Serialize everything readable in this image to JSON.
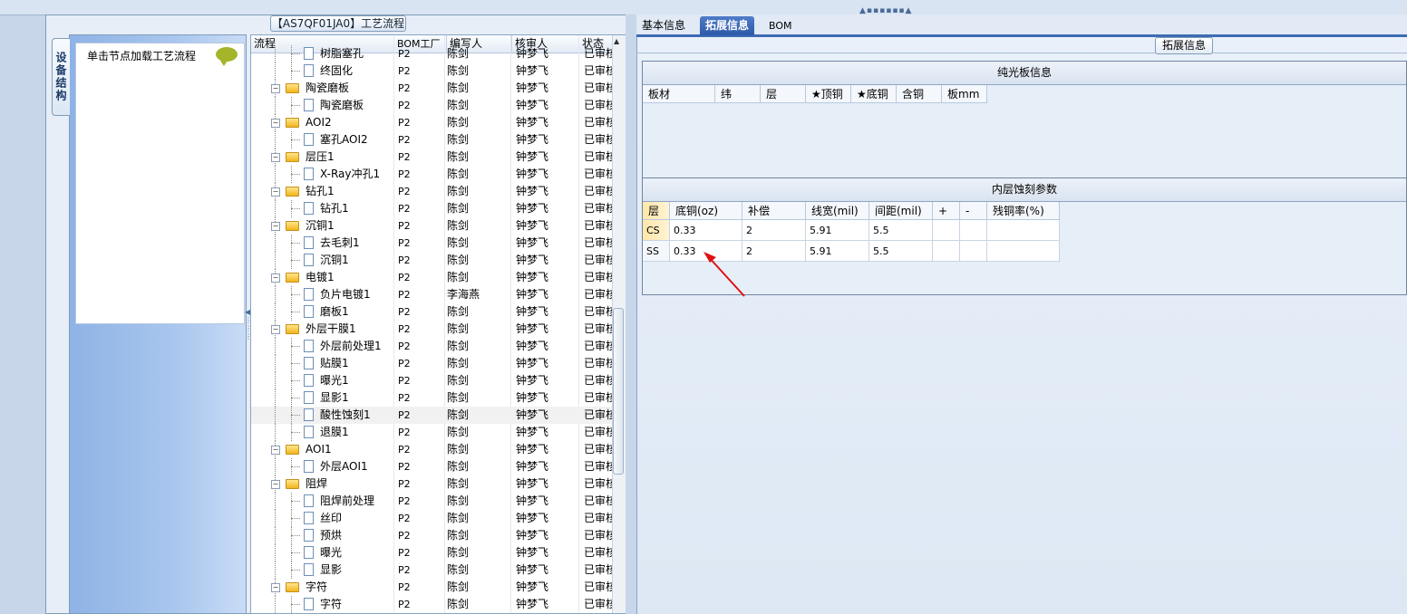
{
  "grid": {
    "title": "【AS7QF01JA0】工艺流程",
    "columns": [
      "流程",
      "BOM工厂",
      "编写人",
      "核审人",
      "状态"
    ],
    "rows": [
      {
        "name": "树脂塞孔",
        "level": 2,
        "type": "file",
        "bom": "P2",
        "writer": "陈剑",
        "reviewer": "钟梦飞",
        "status": "已审核"
      },
      {
        "name": "终固化",
        "level": 2,
        "type": "file",
        "bom": "P2",
        "writer": "陈剑",
        "reviewer": "钟梦飞",
        "status": "已审核"
      },
      {
        "name": "陶瓷磨板",
        "level": 1,
        "type": "folder",
        "bom": "P2",
        "writer": "陈剑",
        "reviewer": "钟梦飞",
        "status": "已审核"
      },
      {
        "name": "陶瓷磨板",
        "level": 2,
        "type": "file",
        "bom": "P2",
        "writer": "陈剑",
        "reviewer": "钟梦飞",
        "status": "已审核"
      },
      {
        "name": "AOI2",
        "level": 1,
        "type": "folder",
        "bom": "P2",
        "writer": "陈剑",
        "reviewer": "钟梦飞",
        "status": "已审核"
      },
      {
        "name": "塞孔AOI2",
        "level": 2,
        "type": "file",
        "bom": "P2",
        "writer": "陈剑",
        "reviewer": "钟梦飞",
        "status": "已审核"
      },
      {
        "name": "层压1",
        "level": 1,
        "type": "folder",
        "bom": "P2",
        "writer": "陈剑",
        "reviewer": "钟梦飞",
        "status": "已审核"
      },
      {
        "name": "X-Ray冲孔1",
        "level": 2,
        "type": "file",
        "bom": "P2",
        "writer": "陈剑",
        "reviewer": "钟梦飞",
        "status": "已审核"
      },
      {
        "name": "钻孔1",
        "level": 1,
        "type": "folder",
        "bom": "P2",
        "writer": "陈剑",
        "reviewer": "钟梦飞",
        "status": "已审核"
      },
      {
        "name": "钻孔1",
        "level": 2,
        "type": "file",
        "bom": "P2",
        "writer": "陈剑",
        "reviewer": "钟梦飞",
        "status": "已审核"
      },
      {
        "name": "沉铜1",
        "level": 1,
        "type": "folder",
        "bom": "P2",
        "writer": "陈剑",
        "reviewer": "钟梦飞",
        "status": "已审核"
      },
      {
        "name": "去毛刺1",
        "level": 2,
        "type": "file",
        "bom": "P2",
        "writer": "陈剑",
        "reviewer": "钟梦飞",
        "status": "已审核"
      },
      {
        "name": "沉铜1",
        "level": 2,
        "type": "file",
        "bom": "P2",
        "writer": "陈剑",
        "reviewer": "钟梦飞",
        "status": "已审核"
      },
      {
        "name": "电镀1",
        "level": 1,
        "type": "folder",
        "bom": "P2",
        "writer": "陈剑",
        "reviewer": "钟梦飞",
        "status": "已审核"
      },
      {
        "name": "负片电镀1",
        "level": 2,
        "type": "file",
        "bom": "P2",
        "writer": "李海燕",
        "reviewer": "钟梦飞",
        "status": "已审核"
      },
      {
        "name": "磨板1",
        "level": 2,
        "type": "file",
        "bom": "P2",
        "writer": "陈剑",
        "reviewer": "钟梦飞",
        "status": "已审核"
      },
      {
        "name": "外层干膜1",
        "level": 1,
        "type": "folder",
        "bom": "P2",
        "writer": "陈剑",
        "reviewer": "钟梦飞",
        "status": "已审核"
      },
      {
        "name": "外层前处理1",
        "level": 2,
        "type": "file",
        "bom": "P2",
        "writer": "陈剑",
        "reviewer": "钟梦飞",
        "status": "已审核"
      },
      {
        "name": "贴膜1",
        "level": 2,
        "type": "file",
        "bom": "P2",
        "writer": "陈剑",
        "reviewer": "钟梦飞",
        "status": "已审核"
      },
      {
        "name": "曝光1",
        "level": 2,
        "type": "file",
        "bom": "P2",
        "writer": "陈剑",
        "reviewer": "钟梦飞",
        "status": "已审核"
      },
      {
        "name": "显影1",
        "level": 2,
        "type": "file",
        "bom": "P2",
        "writer": "陈剑",
        "reviewer": "钟梦飞",
        "status": "已审核"
      },
      {
        "name": "酸性蚀刻1",
        "level": 2,
        "type": "file",
        "bom": "P2",
        "writer": "陈剑",
        "reviewer": "钟梦飞",
        "status": "已审核",
        "selected": true
      },
      {
        "name": "退膜1",
        "level": 2,
        "type": "file",
        "bom": "P2",
        "writer": "陈剑",
        "reviewer": "钟梦飞",
        "status": "已审核"
      },
      {
        "name": "AOI1",
        "level": 1,
        "type": "folder",
        "bom": "P2",
        "writer": "陈剑",
        "reviewer": "钟梦飞",
        "status": "已审核"
      },
      {
        "name": "外层AOI1",
        "level": 2,
        "type": "file",
        "bom": "P2",
        "writer": "陈剑",
        "reviewer": "钟梦飞",
        "status": "已审核"
      },
      {
        "name": "阻焊",
        "level": 1,
        "type": "folder",
        "bom": "P2",
        "writer": "陈剑",
        "reviewer": "钟梦飞",
        "status": "已审核"
      },
      {
        "name": "阻焊前处理",
        "level": 2,
        "type": "file",
        "bom": "P2",
        "writer": "陈剑",
        "reviewer": "钟梦飞",
        "status": "已审核"
      },
      {
        "name": "丝印",
        "level": 2,
        "type": "file",
        "bom": "P2",
        "writer": "陈剑",
        "reviewer": "钟梦飞",
        "status": "已审核"
      },
      {
        "name": "预烘",
        "level": 2,
        "type": "file",
        "bom": "P2",
        "writer": "陈剑",
        "reviewer": "钟梦飞",
        "status": "已审核"
      },
      {
        "name": "曝光",
        "level": 2,
        "type": "file",
        "bom": "P2",
        "writer": "陈剑",
        "reviewer": "钟梦飞",
        "status": "已审核"
      },
      {
        "name": "显影",
        "level": 2,
        "type": "file",
        "bom": "P2",
        "writer": "陈剑",
        "reviewer": "钟梦飞",
        "status": "已审核"
      },
      {
        "name": "字符",
        "level": 1,
        "type": "folder",
        "bom": "P2",
        "writer": "陈剑",
        "reviewer": "钟梦飞",
        "status": "已审核"
      },
      {
        "name": "字符",
        "level": 2,
        "type": "file",
        "bom": "P2",
        "writer": "陈剑",
        "reviewer": "钟梦飞",
        "status": "已审核"
      }
    ]
  },
  "left": {
    "vtab_label": "设备结构",
    "hint": "单击节点加载工艺流程",
    "hint_icon": "speech-bubble-icon"
  },
  "right": {
    "tabs": [
      "基本信息",
      "拓展信息",
      "BOM"
    ],
    "active_tab": 1,
    "group_title": "拓展信息",
    "panel1": {
      "title": "纯光板信息",
      "headers": [
        "板材",
        "纬",
        "层",
        "★顶铜",
        "★底铜",
        "含铜",
        "板mm"
      ]
    },
    "panel2": {
      "title": "内层蚀刻参数",
      "headers": [
        "层",
        "底铜(oz)",
        "补偿",
        "线宽(mil)",
        "间距(mil)",
        "+",
        "-",
        "残铜率(%)"
      ],
      "rows": [
        [
          "CS",
          "0.33",
          "2",
          "5.91",
          "5.5",
          "",
          "",
          ""
        ],
        [
          "SS",
          "0.33",
          "2",
          "5.91",
          "5.5",
          "",
          "",
          ""
        ]
      ]
    },
    "annotation_color": "#e01010"
  }
}
